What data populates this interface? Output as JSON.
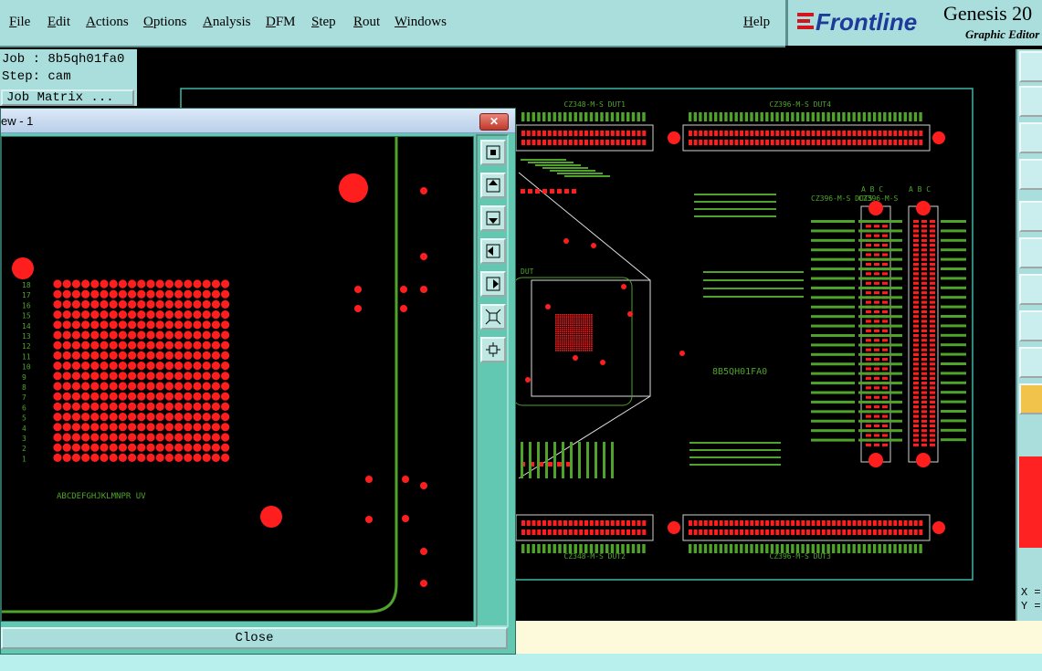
{
  "menubar": {
    "items": [
      "File",
      "Edit",
      "Actions",
      "Options",
      "Analysis",
      "DFM",
      "Step",
      "Rout",
      "Windows"
    ],
    "help": "Help"
  },
  "brand": {
    "logo_text": "Frontline",
    "title": "Genesis 20",
    "subtitle": "Graphic Editor"
  },
  "job": {
    "job_line": "Job : 8b5qh01fa0",
    "step_line": "Step: cam",
    "matrix_button": "Job Matrix ..."
  },
  "zoom_window": {
    "title": "ew - 1",
    "close_label": "Close",
    "row_labels": [
      "18",
      "17",
      "16",
      "15",
      "14",
      "13",
      "12",
      "11",
      "10",
      "9",
      "8",
      "7",
      "6",
      "5",
      "4",
      "3",
      "2",
      "1"
    ],
    "col_labels": "ABCDEFGHJKLMNPR  UV"
  },
  "board": {
    "part_marking": "8B5QH01FA0",
    "connectors": [
      {
        "name": "CZ348-M-S",
        "label": "DUT1"
      },
      {
        "name": "CZ396-M-S",
        "label": "DUT4"
      },
      {
        "name": "CZ396-M-S",
        "label": "DUT5"
      },
      {
        "name": "CZ396-M-S",
        "label": "DUT10"
      },
      {
        "name": "CZ348-M-S",
        "label": "DUT2"
      },
      {
        "name": "CZ396-M-S",
        "label": "DUT3"
      }
    ],
    "dut_label": "DUT",
    "abc": "A B C"
  },
  "coords": {
    "x_label": "X =",
    "y_label": "Y ="
  },
  "colors": {
    "panel": "#a9dedd",
    "trace_green": "#4fa32a",
    "pad_red": "#ff1e1e",
    "window_teal": "#63c8b2"
  }
}
